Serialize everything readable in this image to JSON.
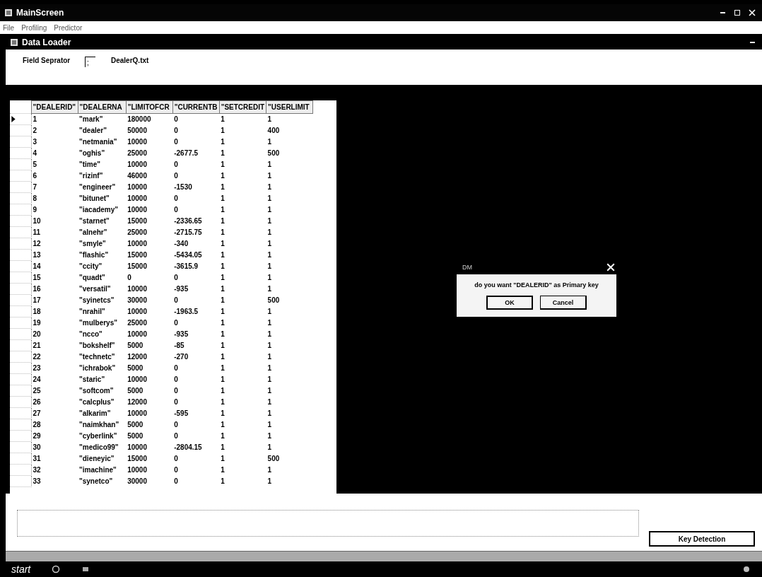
{
  "window": {
    "title": "MainScreen"
  },
  "menu": [
    "File",
    "Profiling",
    "Predictor"
  ],
  "child_window": {
    "title": "Data Loader"
  },
  "field_separator": {
    "label": "Field Seprator",
    "value": ";",
    "file_name": "DealerQ.txt"
  },
  "table": {
    "columns": [
      "\"DEALERID\"",
      "\"DEALERNA",
      "\"LIMITOFCR",
      "\"CURRENTB",
      "\"SETCREDIT",
      "\"USERLIMIT"
    ],
    "rows": [
      {
        "selected": true,
        "cells": [
          "1",
          "\"mark\"",
          "180000",
          "0",
          "1",
          "1"
        ]
      },
      {
        "selected": false,
        "cells": [
          "2",
          "\"dealer\"",
          "50000",
          "0",
          "1",
          "400"
        ]
      },
      {
        "selected": false,
        "cells": [
          "3",
          "\"netmania\"",
          "10000",
          "0",
          "1",
          "1"
        ]
      },
      {
        "selected": false,
        "cells": [
          "4",
          "\"oghis\"",
          "25000",
          "-2677.5",
          "1",
          "500"
        ]
      },
      {
        "selected": false,
        "cells": [
          "5",
          "\"time\"",
          "10000",
          "0",
          "1",
          "1"
        ]
      },
      {
        "selected": false,
        "cells": [
          "6",
          "\"rizinf\"",
          "46000",
          "0",
          "1",
          "1"
        ]
      },
      {
        "selected": false,
        "cells": [
          "7",
          "\"engineer\"",
          "10000",
          "-1530",
          "1",
          "1"
        ]
      },
      {
        "selected": false,
        "cells": [
          "8",
          "\"bitunet\"",
          "10000",
          "0",
          "1",
          "1"
        ]
      },
      {
        "selected": false,
        "cells": [
          "9",
          "\"iacademy\"",
          "10000",
          "0",
          "1",
          "1"
        ]
      },
      {
        "selected": false,
        "cells": [
          "10",
          "\"starnet\"",
          "15000",
          "-2336.65",
          "1",
          "1"
        ]
      },
      {
        "selected": false,
        "cells": [
          "11",
          "\"alnehr\"",
          "25000",
          "-2715.75",
          "1",
          "1"
        ]
      },
      {
        "selected": false,
        "cells": [
          "12",
          "\"smyle\"",
          "10000",
          "-340",
          "1",
          "1"
        ]
      },
      {
        "selected": false,
        "cells": [
          "13",
          "\"flashic\"",
          "15000",
          "-5434.05",
          "1",
          "1"
        ]
      },
      {
        "selected": false,
        "cells": [
          "14",
          "\"ccity\"",
          "15000",
          "-3615.9",
          "1",
          "1"
        ]
      },
      {
        "selected": false,
        "cells": [
          "15",
          "\"quadt\"",
          "0",
          "0",
          "1",
          "1"
        ]
      },
      {
        "selected": false,
        "cells": [
          "16",
          "\"versatil\"",
          "10000",
          "-935",
          "1",
          "1"
        ]
      },
      {
        "selected": false,
        "cells": [
          "17",
          "\"syinetcs\"",
          "30000",
          "0",
          "1",
          "500"
        ]
      },
      {
        "selected": false,
        "cells": [
          "18",
          "\"nrahil\"",
          "10000",
          "-1963.5",
          "1",
          "1"
        ]
      },
      {
        "selected": false,
        "cells": [
          "19",
          "\"mulberys\"",
          "25000",
          "0",
          "1",
          "1"
        ]
      },
      {
        "selected": false,
        "cells": [
          "20",
          "\"ncco\"",
          "10000",
          "-935",
          "1",
          "1"
        ]
      },
      {
        "selected": false,
        "cells": [
          "21",
          "\"bokshelf\"",
          "5000",
          "-85",
          "1",
          "1"
        ]
      },
      {
        "selected": false,
        "cells": [
          "22",
          "\"technetc\"",
          "12000",
          "-270",
          "1",
          "1"
        ]
      },
      {
        "selected": false,
        "cells": [
          "23",
          "\"ichrabok\"",
          "5000",
          "0",
          "1",
          "1"
        ]
      },
      {
        "selected": false,
        "cells": [
          "24",
          "\"staric\"",
          "10000",
          "0",
          "1",
          "1"
        ]
      },
      {
        "selected": false,
        "cells": [
          "25",
          "\"softcom\"",
          "5000",
          "0",
          "1",
          "1"
        ]
      },
      {
        "selected": false,
        "cells": [
          "26",
          "\"calcplus\"",
          "12000",
          "0",
          "1",
          "1"
        ]
      },
      {
        "selected": false,
        "cells": [
          "27",
          "\"alkarim\"",
          "10000",
          "-595",
          "1",
          "1"
        ]
      },
      {
        "selected": false,
        "cells": [
          "28",
          "\"naimkhan\"",
          "5000",
          "0",
          "1",
          "1"
        ]
      },
      {
        "selected": false,
        "cells": [
          "29",
          "\"cyberlink\"",
          "5000",
          "0",
          "1",
          "1"
        ]
      },
      {
        "selected": false,
        "cells": [
          "30",
          "\"medico99\"",
          "10000",
          "-2804.15",
          "1",
          "1"
        ]
      },
      {
        "selected": false,
        "cells": [
          "31",
          "\"dieneyic\"",
          "15000",
          "0",
          "1",
          "500"
        ]
      },
      {
        "selected": false,
        "cells": [
          "32",
          "\"imachine\"",
          "10000",
          "0",
          "1",
          "1"
        ]
      },
      {
        "selected": false,
        "cells": [
          "33",
          "\"synetco\"",
          "30000",
          "0",
          "1",
          "1"
        ]
      }
    ]
  },
  "dialog": {
    "title": "DM",
    "message": "do you want  \"DEALERID\" as Primary key",
    "buttons": [
      "OK",
      "Cancel"
    ]
  },
  "key_detection_button": "Key Detection",
  "taskbar": {
    "start": "start"
  }
}
